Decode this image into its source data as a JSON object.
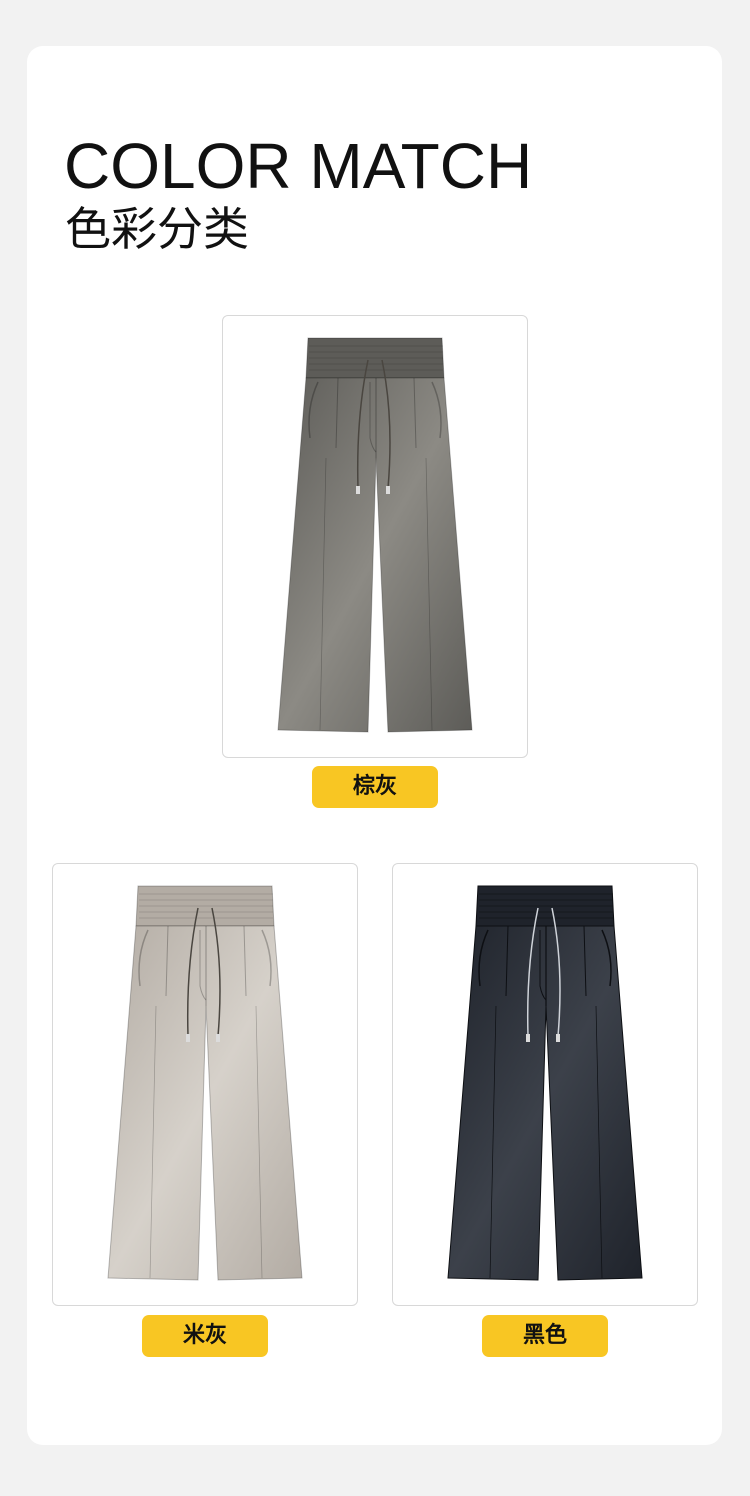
{
  "header": {
    "title_en": "COLOR MATCH",
    "title_cn": "色彩分类"
  },
  "products": [
    {
      "label": "棕灰",
      "color": "#5d5c58",
      "shade": "#8c8a84",
      "icon": "pants-icon"
    },
    {
      "label": "米灰",
      "color": "#b3aca4",
      "shade": "#d6d1ca",
      "icon": "pants-icon"
    },
    {
      "label": "黑色",
      "color": "#1f232b",
      "shade": "#3c414a",
      "icon": "pants-icon"
    }
  ],
  "accent_color": "#f8c623"
}
